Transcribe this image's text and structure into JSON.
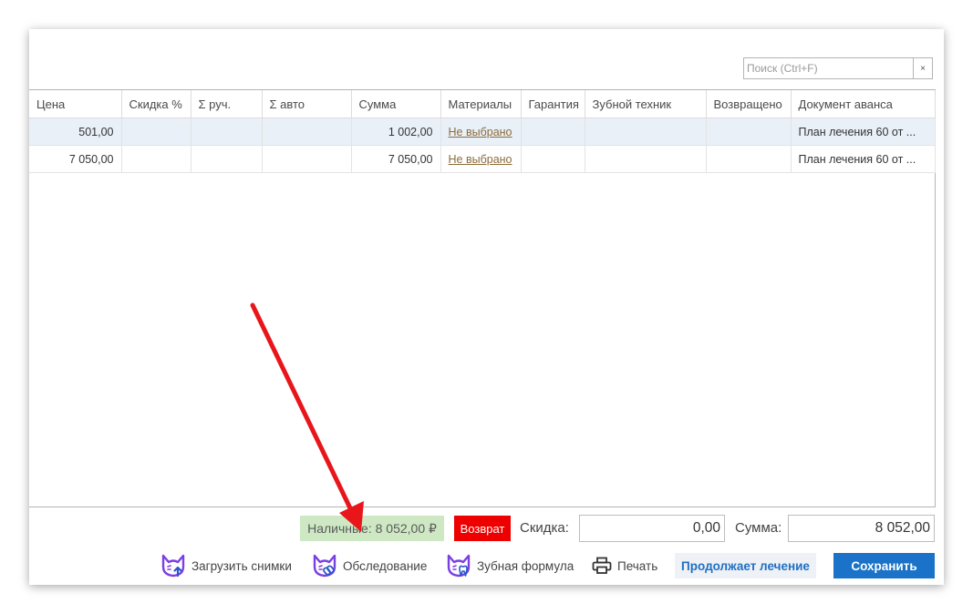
{
  "search": {
    "placeholder": "Поиск (Ctrl+F)",
    "clear_label": "×"
  },
  "table": {
    "columns": [
      "Цена",
      "Скидка %",
      "Σ руч.",
      "Σ авто",
      "Сумма",
      "Материалы",
      "Гарантия",
      "Зубной техник",
      "Возвращено",
      "Документ аванса"
    ],
    "rows": [
      {
        "price": "501,00",
        "discount": "",
        "manual": "",
        "auto": "",
        "sum": "1 002,00",
        "materials": "Не выбрано",
        "warranty": "",
        "technician": "",
        "returned": "",
        "advance_doc": "План лечения 60 от ..."
      },
      {
        "price": "7 050,00",
        "discount": "",
        "manual": "",
        "auto": "",
        "sum": "7 050,00",
        "materials": "Не выбрано",
        "warranty": "",
        "technician": "",
        "returned": "",
        "advance_doc": "План лечения 60 от ..."
      }
    ]
  },
  "footer": {
    "cash": "Наличные: 8 052,00 ₽",
    "refund": "Возврат",
    "discount_label": "Скидка:",
    "discount_value": "0,00",
    "sum_label": "Сумма:",
    "sum_value": "8 052,00"
  },
  "toolbar": {
    "upload_images": "Загрузить снимки",
    "examination": "Обследование",
    "dental_formula": "Зубная формула",
    "print": "Печать",
    "continues_treatment": "Продолжает лечение",
    "save": "Сохранить"
  },
  "colors": {
    "accent": "#1a73c8",
    "refund": "#ee0000",
    "cash_bg": "#cde8c3",
    "brand_icon": "#7b3fe4",
    "annotation_arrow": "#e8161b"
  },
  "icons": [
    "brand-upload-icon",
    "brand-link-icon",
    "brand-tooth-icon",
    "printer-icon"
  ]
}
